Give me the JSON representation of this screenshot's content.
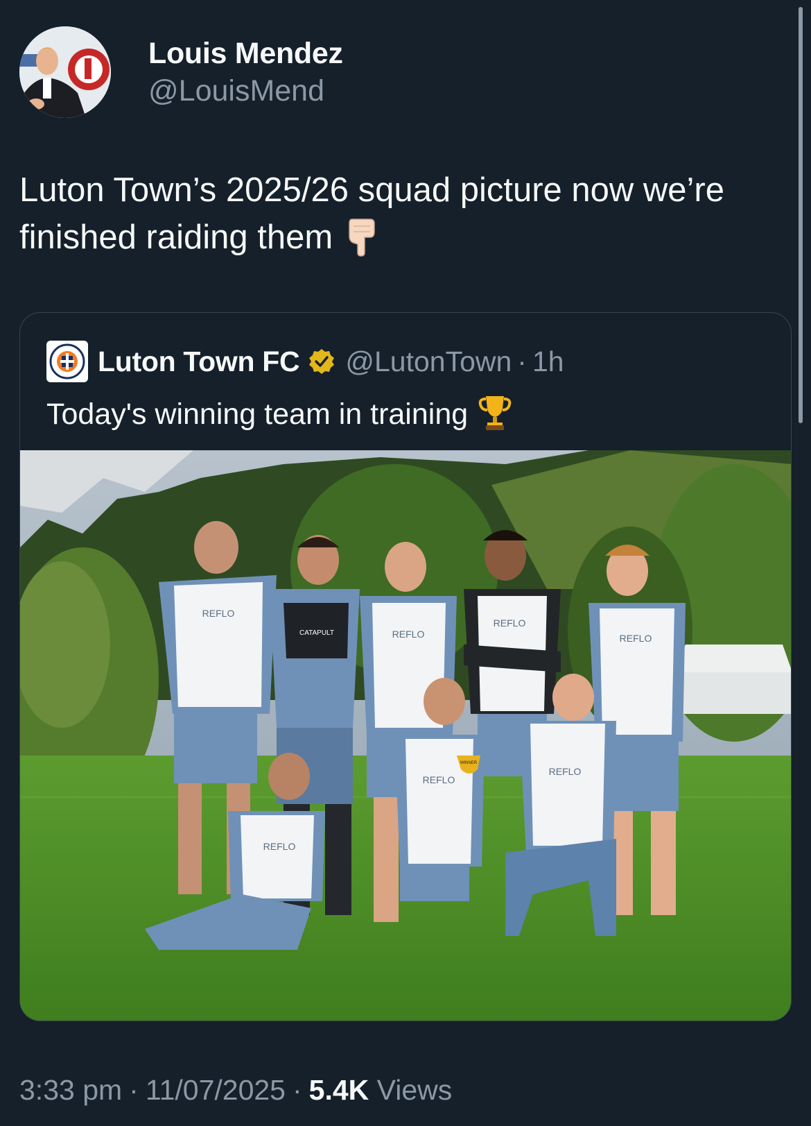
{
  "author": {
    "display_name": "Louis Mendez",
    "handle": "@LouisMend"
  },
  "tweet": {
    "text": "Luton Town’s 2025/26 squad picture now we’re finished raiding them",
    "emoji": "backhand-index-pointing-down"
  },
  "quoted": {
    "name": "Luton Town FC",
    "handle": "@LutonTown",
    "separator": "·",
    "time": "1h",
    "text": "Today's winning team in training",
    "emoji": "trophy",
    "image": {
      "bib_text": "REFLO",
      "sponsor_text": "CATAPULT",
      "trophy_text": "WINNER"
    }
  },
  "meta": {
    "time": "3:33 pm",
    "separator": "·",
    "date": "11/07/2025",
    "views_count": "5.4K",
    "views_label": "Views"
  },
  "colors": {
    "background": "#15202b",
    "secondary_text": "#8b98a5",
    "border": "#38444d",
    "verified_gold": "#e2b719"
  }
}
